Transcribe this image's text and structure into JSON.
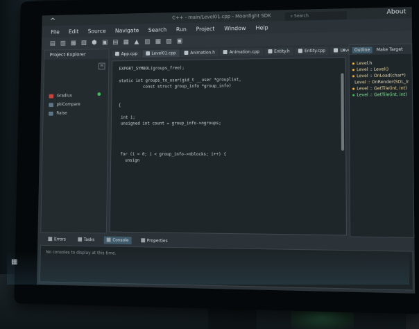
{
  "window": {
    "logo": "^",
    "title": "C++ - main/Level01.cpp - Moonfight SDK",
    "search_placeholder": "Search",
    "about": "About"
  },
  "menu": [
    "File",
    "Edit",
    "Source",
    "Navigate",
    "Search",
    "Run",
    "Project",
    "Window",
    "Help"
  ],
  "toolbar": [
    "▤",
    "▥",
    "▦",
    "▧",
    "⬢",
    "▣",
    "▤",
    "▦",
    "▲",
    "▥",
    "▦",
    "▧",
    "▣"
  ],
  "explorer": {
    "title": "Project Explorer",
    "collapse": "⊟",
    "items": [
      {
        "label": "Gradius",
        "icon": "folder-red-icon"
      },
      {
        "label": "pkiCompare",
        "icon": "folder-icon"
      },
      {
        "label": "Raise",
        "icon": "folder-icon"
      }
    ]
  },
  "editor": {
    "tabs": [
      "App.cpp",
      "Level01.cpp",
      "Animation.h",
      "Animation.cpp",
      "Entity.h",
      "Entity.cpp",
      "Level.h"
    ],
    "close": "×",
    "lines": [
      "EXPORT_SYMBOL(groups_free);",
      "",
      "static int groups_to_user(gid_t __user *grouplist,",
      "          const struct group_info *group_info)",
      "",
      "",
      "{",
      "",
      " int i;",
      " unsigned int count = group_info->ngroups;",
      "",
      "",
      "",
      "",
      " for (i = 0; i < group_info->nblocks; i++) {",
      "   unsign"
    ]
  },
  "outline": {
    "tab_outline": "Outline",
    "tab_make": "Make Target",
    "close": "×",
    "items": [
      {
        "label": "Level.h",
        "color": "#f0b43c"
      },
      {
        "label": "Level :: Level()",
        "color": "#f0b43c"
      },
      {
        "label": "Level :: OnLoad(char*)",
        "color": "#f0b43c"
      },
      {
        "label": "Level :: OnRender(SDL_Int",
        "color": "#f0b43c"
      },
      {
        "label": "Level :: GetTile(int, int)",
        "color": "#f0b43c"
      },
      {
        "label": "Level :: GetTile(int, int)",
        "color": "#3fbf5b"
      }
    ]
  },
  "bottom": {
    "tabs": [
      {
        "label": "Errors",
        "active": false
      },
      {
        "label": "Tasks",
        "active": false
      },
      {
        "label": "Console",
        "active": true
      },
      {
        "label": "Properties",
        "active": false
      }
    ],
    "console_message": "No consoles to display at this time."
  },
  "colors": {
    "accent": "#3e5a6b",
    "status_green": "#3fbf5b",
    "bullet_orange": "#f0b43c"
  }
}
